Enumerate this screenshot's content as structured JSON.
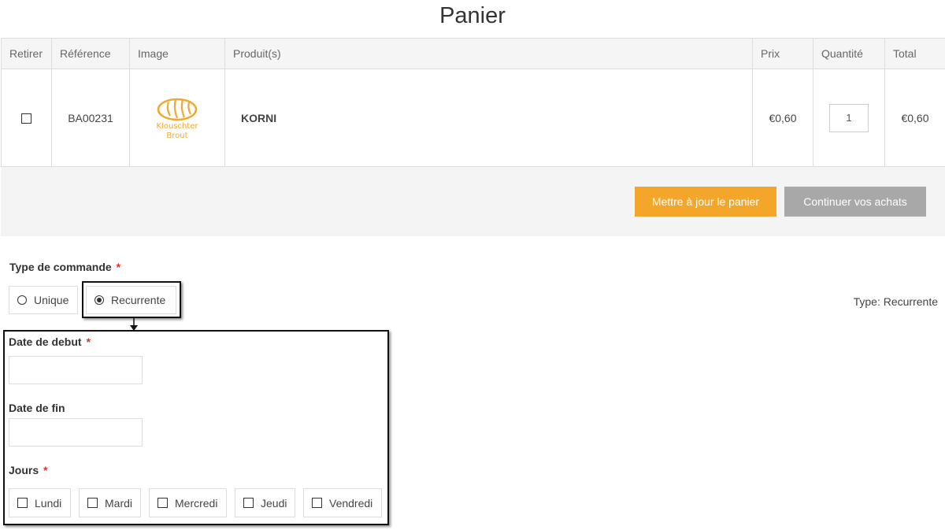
{
  "page": {
    "title": "Panier"
  },
  "cart": {
    "headers": [
      "Retirer",
      "Référence",
      "Image",
      "Produit(s)",
      "Prix",
      "Quantité",
      "Total"
    ],
    "rows": [
      {
        "remove_checked": false,
        "reference": "BA00231",
        "logo_text_line1": "Klouschter",
        "logo_text_line2": "Brout",
        "product": "KORNI",
        "price": "€0,60",
        "quantity": "1",
        "total": "€0,60"
      }
    ]
  },
  "actions": {
    "update_label": "Mettre à jour le panier",
    "continue_label": "Continuer vos achats",
    "update_color": "#f4a62a",
    "continue_color": "#a8a8a8"
  },
  "order_type": {
    "label": "Type de commande",
    "required_mark": "*",
    "options": [
      {
        "label": "Unique",
        "selected": false
      },
      {
        "label": "Recurrente",
        "selected": true
      }
    ],
    "summary": "Type: Recurrente"
  },
  "recurrence": {
    "start_label": "Date de debut",
    "start_required": "*",
    "start_value": "",
    "end_label": "Date de fin",
    "end_value": "",
    "days_label": "Jours",
    "days_required": "*",
    "days": [
      {
        "label": "Lundi",
        "checked": false
      },
      {
        "label": "Mardi",
        "checked": false
      },
      {
        "label": "Mercredi",
        "checked": false
      },
      {
        "label": "Jeudi",
        "checked": false
      },
      {
        "label": "Vendredi",
        "checked": false
      }
    ]
  }
}
